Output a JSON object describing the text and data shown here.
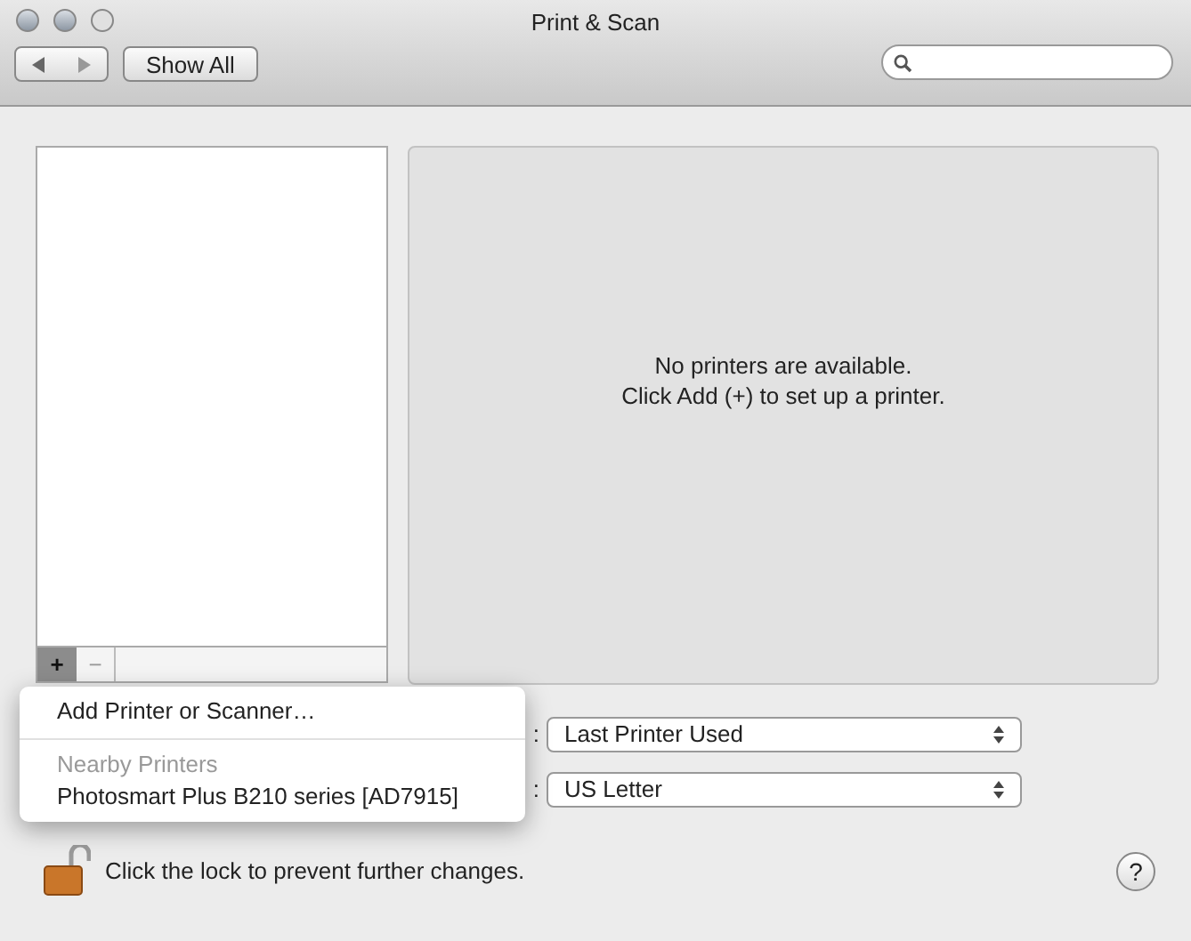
{
  "window": {
    "title": "Print & Scan"
  },
  "toolbar": {
    "show_all": "Show All"
  },
  "printer_list": {
    "add": "+",
    "remove": "−"
  },
  "message": [
    "No printers are available.",
    "Click Add (+) to set up a printer."
  ],
  "settings": [
    {
      "label": ":",
      "value": "Last Printer Used"
    },
    {
      "label": ":",
      "value": "US Letter"
    }
  ],
  "add_menu": {
    "items": [
      {
        "kind": "item",
        "label": "Add Printer or Scanner…"
      },
      {
        "kind": "separator"
      },
      {
        "kind": "header",
        "label": "Nearby Printers"
      },
      {
        "kind": "item",
        "label": "Photosmart Plus B210 series [AD7915]"
      }
    ]
  },
  "lock": {
    "text": "Click the lock to prevent further changes."
  },
  "help": "?"
}
